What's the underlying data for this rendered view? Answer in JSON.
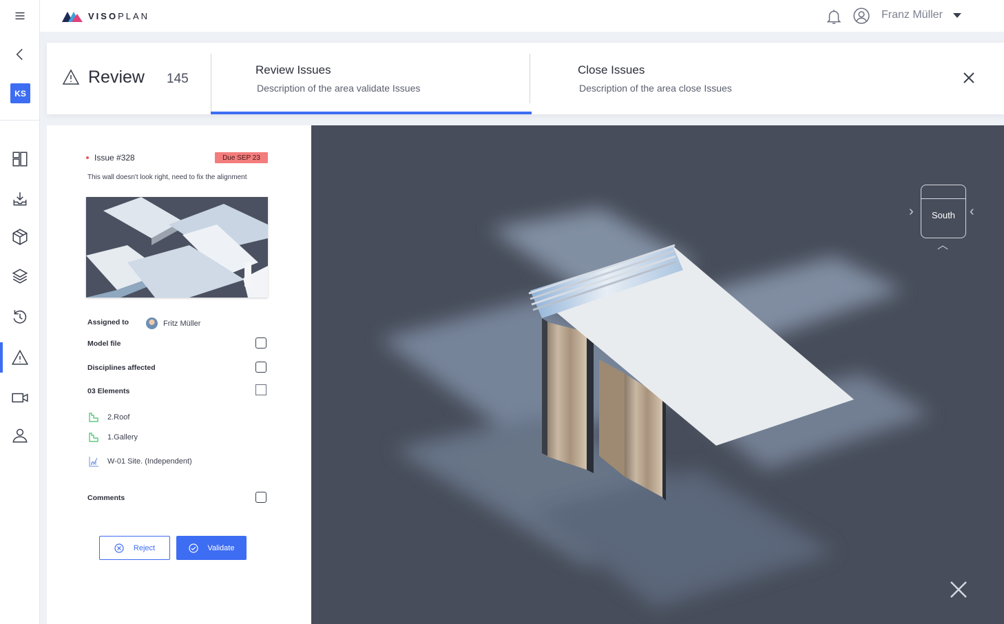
{
  "app": {
    "brand_strong": "VISO",
    "brand_light": "PLAN"
  },
  "rail": {
    "workspace_badge": "KS",
    "icons": [
      "menu-icon",
      "back-icon",
      "dashboard-icon",
      "download-tray-icon",
      "cube-icon",
      "layers-icon",
      "history-icon",
      "warning-icon",
      "video-icon",
      "user-icon"
    ],
    "active_item": "warning-icon"
  },
  "user": {
    "name": "Franz Müller"
  },
  "header": {
    "title": "Review",
    "count": "145",
    "tabs": [
      {
        "title": "Review Issues",
        "description": "Description of the area validate Issues",
        "active": true
      },
      {
        "title": "Close Issues",
        "description": "Description of the area close Issues",
        "active": false
      }
    ]
  },
  "issue": {
    "id": "Issue #328",
    "due": "Due SEP 23",
    "description": "This wall doesn't look right, need to fix the alignment",
    "assigned_label": "Assigned to",
    "assignee": "Fritz Müller",
    "fields": [
      {
        "label": "Model file",
        "checked": false
      },
      {
        "label": "Disciplines affected",
        "checked": false
      },
      {
        "label": "03 Elements",
        "checked": false
      },
      {
        "label": "Comments",
        "checked": false
      }
    ],
    "elements": [
      {
        "name": "2.Roof",
        "icon": "floor-level-icon"
      },
      {
        "name": "1.Gallery",
        "icon": "floor-level-icon"
      },
      {
        "name": "W-01 Site. (Independent)",
        "icon": "site-chart-icon"
      }
    ],
    "reject_label": "Reject",
    "validate_label": "Validate"
  },
  "viewer": {
    "view_direction": "South"
  },
  "colors": {
    "accent": "#3d6df2",
    "due_badge": "#f37d7d",
    "viewer_bg": "#474d5a",
    "element_icon": "#3fbf6b"
  }
}
